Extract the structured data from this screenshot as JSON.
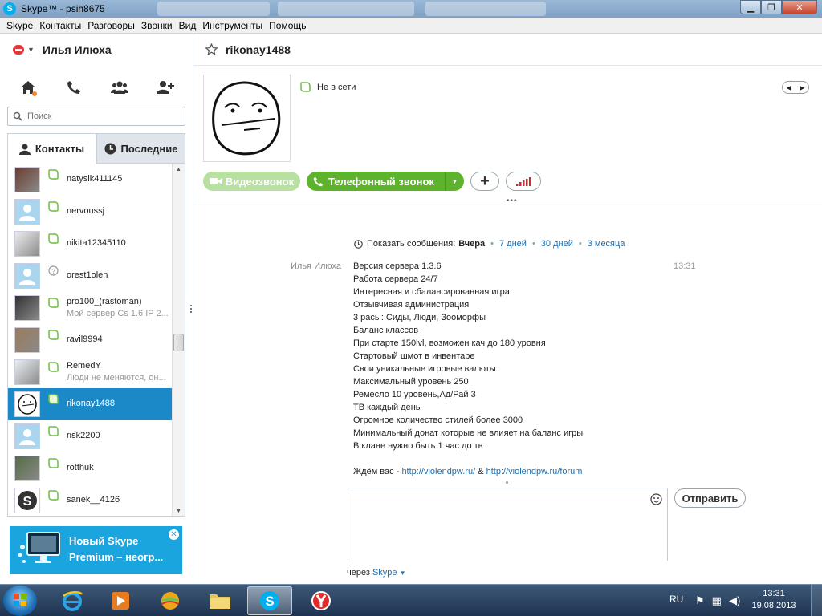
{
  "window": {
    "title": "Skype™ - psih8675"
  },
  "menu": [
    "Skype",
    "Контакты",
    "Разговоры",
    "Звонки",
    "Вид",
    "Инструменты",
    "Помощь"
  ],
  "user": {
    "name": "Илья Илюха"
  },
  "search": {
    "placeholder": "Поиск"
  },
  "tabs": {
    "contacts": "Контакты",
    "recent": "Последние"
  },
  "contacts": [
    {
      "name": "natysik411145",
      "mood": "",
      "avatar": "photo",
      "status": "offline"
    },
    {
      "name": "nervoussj",
      "mood": "",
      "avatar": "placeholder",
      "status": "offline"
    },
    {
      "name": "nikita12345110",
      "mood": "",
      "avatar": "photo",
      "status": "offline"
    },
    {
      "name": "orest1olen",
      "mood": "",
      "avatar": "placeholder",
      "status": "unknown"
    },
    {
      "name": "pro100_(rastoman)",
      "mood": "Мой сервер Cs 1.6 IP 2...",
      "avatar": "photo",
      "status": "offline"
    },
    {
      "name": "ravil9994",
      "mood": "",
      "avatar": "photo",
      "status": "offline"
    },
    {
      "name": "RemedY",
      "mood": "Люди не меняются, он...",
      "avatar": "photo",
      "status": "offline"
    },
    {
      "name": "rikonay1488",
      "mood": "",
      "avatar": "face",
      "status": "offline",
      "selected": true
    },
    {
      "name": "risk2200",
      "mood": "",
      "avatar": "placeholder",
      "status": "offline"
    },
    {
      "name": "rotthuk",
      "mood": "",
      "avatar": "photo",
      "status": "offline"
    },
    {
      "name": "sanek__4126",
      "mood": "",
      "avatar": "skype",
      "status": "offline"
    }
  ],
  "promo": {
    "line1": "Новый Skype",
    "line2": "Premium – неогр..."
  },
  "conversation": {
    "title": "rikonay1488",
    "presence": "Не в сети",
    "video_label": "Видеозвонок",
    "call_label": "Телефонный звонок",
    "show_messages": "Показать сообщения:",
    "range_current": "Вчера",
    "range_links": [
      "7 дней",
      "30 дней",
      "3 месяца"
    ],
    "message": {
      "author": "Илья Илюха",
      "time": "13:31",
      "lines": [
        "Версия сервера 1.3.6",
        "Работа сервера 24/7",
        "Интересная и сбалансированная игра",
        "Отзывчивая администрация",
        "3 расы: Сиды, Люди, Зооморфы",
        "Баланс классов",
        "При старте 150lvl, возможен кач до 180 уровня",
        "Стартовый шмот в инвентаре",
        "Свои уникальные игровые валюты",
        "Максимальный уровень 250",
        "Ремесло 10 уровень,Ад/Рай 3",
        "ТВ каждый день",
        "Огромное количество стилей более 3000",
        "Минимальный донат которые не влияет на баланс игры",
        "В клане нужно быть 1 час до тв"
      ],
      "last_prefix": "Ждём вас - ",
      "link1": "http://violendpw.ru/",
      "link_sep": " & ",
      "link2": "http://violendpw.ru/forum"
    },
    "send_label": "Отправить",
    "via_prefix": "через",
    "via_link": "Skype"
  },
  "taskbar": {
    "lang": "RU",
    "time": "13:31",
    "date": "19.08.2013"
  },
  "colors": {
    "skype_blue": "#00aff0",
    "selected": "#1b88c7",
    "call_green": "#5db32c",
    "video_green": "#b8e0a0",
    "link": "#1b6fb2"
  }
}
